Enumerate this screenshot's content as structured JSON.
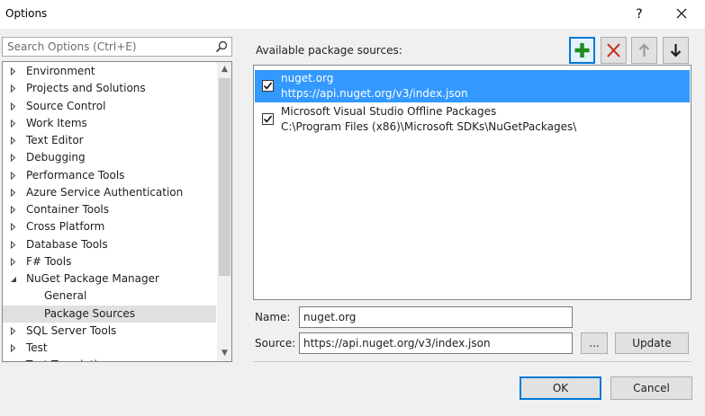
{
  "window": {
    "title": "Options",
    "help_glyph": "?",
    "close_glyph": "✕"
  },
  "search": {
    "placeholder": "Search Options (Ctrl+E)"
  },
  "tree": {
    "items": [
      {
        "label": "Environment",
        "level": 0,
        "state": "collapsed"
      },
      {
        "label": "Projects and Solutions",
        "level": 0,
        "state": "collapsed"
      },
      {
        "label": "Source Control",
        "level": 0,
        "state": "collapsed"
      },
      {
        "label": "Work Items",
        "level": 0,
        "state": "collapsed"
      },
      {
        "label": "Text Editor",
        "level": 0,
        "state": "collapsed"
      },
      {
        "label": "Debugging",
        "level": 0,
        "state": "collapsed"
      },
      {
        "label": "Performance Tools",
        "level": 0,
        "state": "collapsed"
      },
      {
        "label": "Azure Service Authentication",
        "level": 0,
        "state": "collapsed"
      },
      {
        "label": "Container Tools",
        "level": 0,
        "state": "collapsed"
      },
      {
        "label": "Cross Platform",
        "level": 0,
        "state": "collapsed"
      },
      {
        "label": "Database Tools",
        "level": 0,
        "state": "collapsed"
      },
      {
        "label": "F# Tools",
        "level": 0,
        "state": "collapsed"
      },
      {
        "label": "NuGet Package Manager",
        "level": 0,
        "state": "expanded"
      },
      {
        "label": "General",
        "level": 1,
        "state": "leaf"
      },
      {
        "label": "Package Sources",
        "level": 1,
        "state": "leaf",
        "selected": true
      },
      {
        "label": "SQL Server Tools",
        "level": 0,
        "state": "collapsed"
      },
      {
        "label": "Test",
        "level": 0,
        "state": "collapsed"
      },
      {
        "label": "Text Templating",
        "level": 0,
        "state": "collapsed"
      }
    ]
  },
  "sources": {
    "label": "Available package sources:",
    "toolbar": {
      "add_icon": "plus-icon",
      "remove_icon": "x-icon",
      "up_icon": "arrow-up-icon",
      "down_icon": "arrow-down-icon"
    },
    "items": [
      {
        "name": "nuget.org",
        "source": "https://api.nuget.org/v3/index.json",
        "checked": true,
        "selected": true
      },
      {
        "name": "Microsoft Visual Studio Offline Packages",
        "source": "C:\\Program Files (x86)\\Microsoft SDKs\\NuGetPackages\\",
        "checked": true,
        "selected": false
      }
    ]
  },
  "details": {
    "name_label": "Name:",
    "name_value": "nuget.org",
    "source_label": "Source:",
    "source_value": "https://api.nuget.org/v3/index.json",
    "browse_label": "...",
    "update_label": "Update"
  },
  "footer": {
    "ok_label": "OK",
    "cancel_label": "Cancel"
  },
  "colors": {
    "accent": "#0078d7",
    "selection": "#3399ff",
    "add_green": "#1e8c1e",
    "remove_red": "#c42b1c"
  }
}
